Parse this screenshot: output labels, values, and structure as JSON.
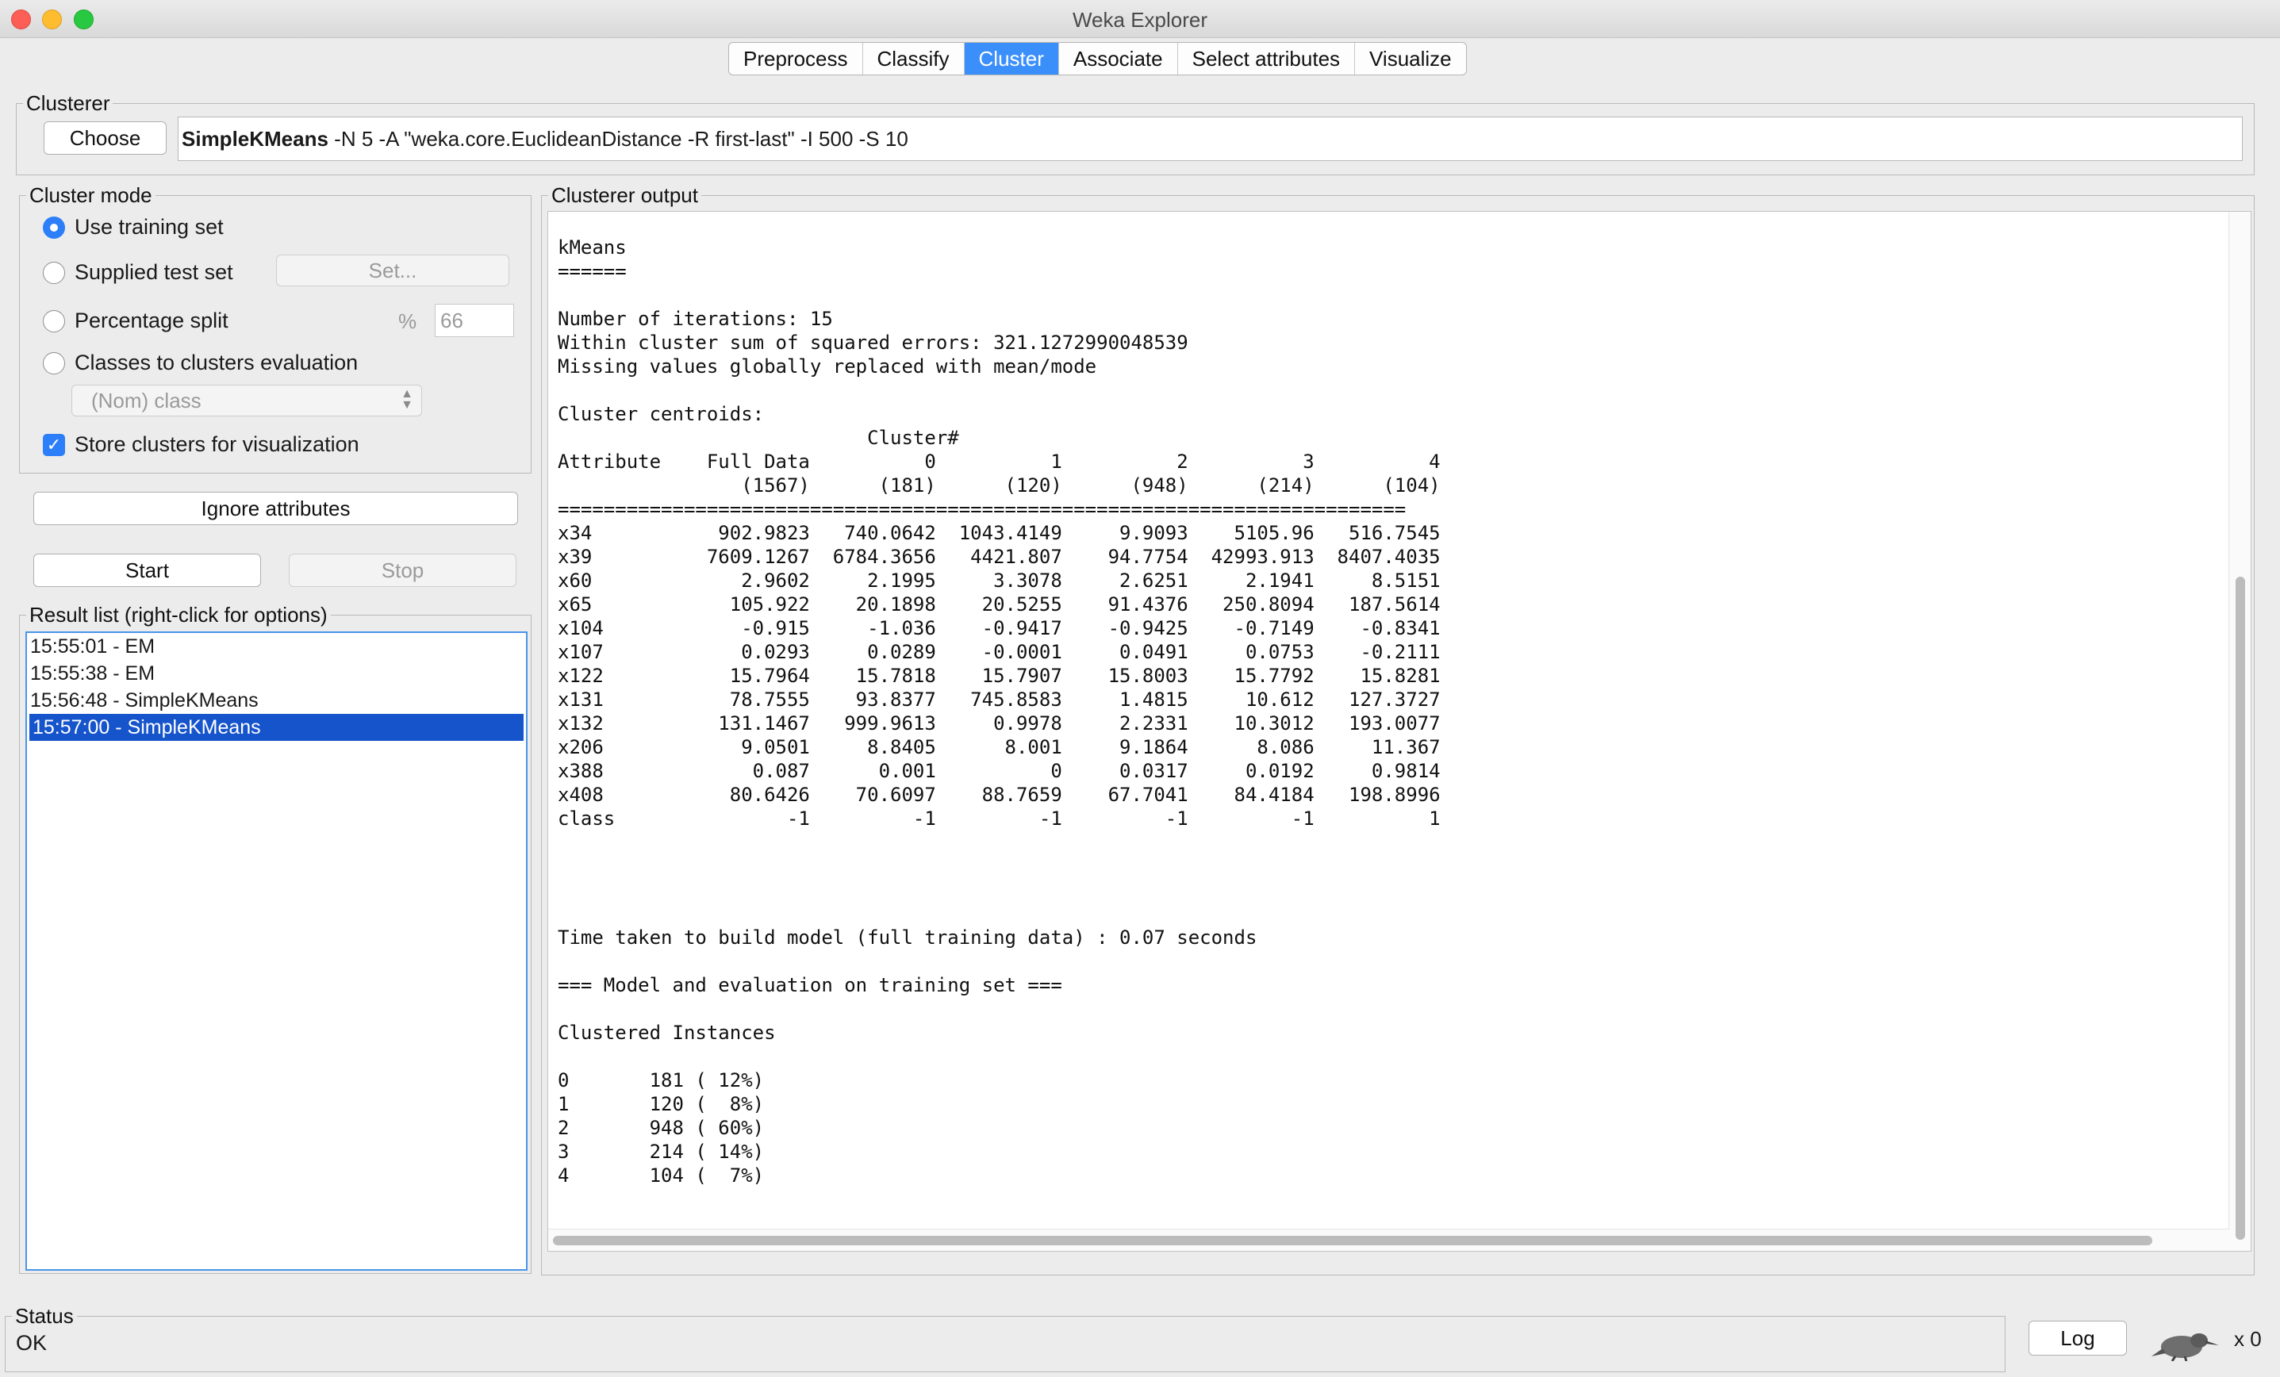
{
  "window": {
    "title": "Weka Explorer"
  },
  "tabs": [
    {
      "label": "Preprocess",
      "active": false
    },
    {
      "label": "Classify",
      "active": false
    },
    {
      "label": "Cluster",
      "active": true
    },
    {
      "label": "Associate",
      "active": false
    },
    {
      "label": "Select attributes",
      "active": false
    },
    {
      "label": "Visualize",
      "active": false
    }
  ],
  "clusterer": {
    "legend": "Clusterer",
    "choose_label": "Choose",
    "algorithm": "SimpleKMeans",
    "options": " -N 5 -A \"weka.core.EuclideanDistance -R first-last\" -I 500 -S 10"
  },
  "cluster_mode": {
    "legend": "Cluster mode",
    "use_training_set": "Use training set",
    "supplied_test_set": "Supplied test set",
    "set_button": "Set...",
    "percentage_split": "Percentage split",
    "percent_sign": "%",
    "percentage_value": "66",
    "classes_to_clusters": "Classes to clusters evaluation",
    "class_select": "(Nom) class",
    "store_clusters": "Store clusters for visualization",
    "selected": "Use training set",
    "store_checked": true
  },
  "buttons": {
    "ignore_attributes": "Ignore attributes",
    "start": "Start",
    "stop": "Stop"
  },
  "result_list": {
    "legend": "Result list (right-click for options)",
    "items": [
      {
        "label": "15:55:01 - EM",
        "selected": false
      },
      {
        "label": "15:55:38 - EM",
        "selected": false
      },
      {
        "label": "15:56:48 - SimpleKMeans",
        "selected": false
      },
      {
        "label": "15:57:00 - SimpleKMeans",
        "selected": true
      }
    ]
  },
  "output": {
    "legend": "Clusterer output",
    "text": "kMeans\n======\n\nNumber of iterations: 15\nWithin cluster sum of squared errors: 321.1272990048539\nMissing values globally replaced with mean/mode\n\nCluster centroids:\n                           Cluster#\nAttribute    Full Data          0          1          2          3          4\n                (1567)      (181)      (120)      (948)      (214)      (104)\n==========================================================================\nx34           902.9823   740.0642  1043.4149     9.9093    5105.96   516.7545\nx39          7609.1267  6784.3656   4421.807    94.7754  42993.913  8407.4035\nx60             2.9602     2.1995     3.3078     2.6251     2.1941     8.5151\nx65            105.922    20.1898    20.5255    91.4376   250.8094   187.5614\nx104            -0.915     -1.036    -0.9417    -0.9425    -0.7149    -0.8341\nx107            0.0293     0.0289    -0.0001     0.0491     0.0753    -0.2111\nx122           15.7964    15.7818    15.7907    15.8003    15.7792    15.8281\nx131           78.7555    93.8377   745.8583     1.4815     10.612   127.3727\nx132          131.1467   999.9613     0.9978     2.2331    10.3012   193.0077\nx206            9.0501     8.8405      8.001     9.1864      8.086     11.367\nx388             0.087      0.001          0     0.0317     0.0192     0.9814\nx408           80.6426    70.6097    88.7659    67.7041    84.4184   198.8996\nclass               -1         -1         -1         -1         -1          1\n\n\n\n\nTime taken to build model (full training data) : 0.07 seconds\n\n=== Model and evaluation on training set ===\n\nClustered Instances\n\n0       181 ( 12%)\n1       120 (  8%)\n2       948 ( 60%)\n3       214 ( 14%)\n4       104 (  7%)"
  },
  "status": {
    "legend": "Status",
    "text": "OK",
    "log_button": "Log",
    "task_count": "x 0"
  }
}
